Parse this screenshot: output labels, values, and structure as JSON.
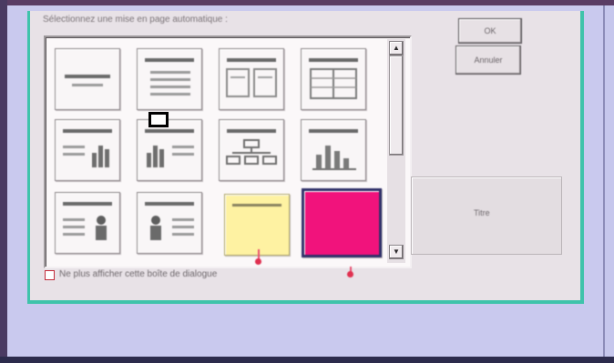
{
  "dialog": {
    "prompt": "Sélectionnez une mise en page automatique :",
    "ok_label": "OK",
    "cancel_label": "Annuler",
    "preview_label": "Titre",
    "dont_show_label": "Ne plus afficher cette boîte de dialogue"
  },
  "gallery": {
    "scroll_up_icon": "scroll-up-arrow-icon",
    "scroll_down_icon": "scroll-down-arrow-icon",
    "tiles": [
      {
        "name": "layout-title-slide",
        "icon": "title-slide-icon"
      },
      {
        "name": "layout-bulleted-list",
        "icon": "bulleted-list-icon"
      },
      {
        "name": "layout-two-columns",
        "icon": "two-column-text-icon"
      },
      {
        "name": "layout-table",
        "icon": "table-icon"
      },
      {
        "name": "layout-text-and-chart",
        "icon": "text-chart-icon"
      },
      {
        "name": "layout-chart-and-text",
        "icon": "chart-text-icon"
      },
      {
        "name": "layout-organization-chart",
        "icon": "org-chart-icon"
      },
      {
        "name": "layout-chart",
        "icon": "chart-icon"
      },
      {
        "name": "layout-text-and-clip-art",
        "icon": "text-clipart-icon"
      },
      {
        "name": "layout-clip-art-and-text",
        "icon": "clipart-text-icon"
      },
      {
        "name": "layout-title-only",
        "icon": "title-only-icon"
      },
      {
        "name": "layout-blank",
        "icon": "blank-icon"
      }
    ]
  },
  "colors": {
    "dialog_face": "#e8e2e7",
    "frame_accent": "#3fc3ab",
    "selected_highlight": "#f1137c",
    "hover_highlight": "#fef2a2",
    "selection_border": "#2f3069",
    "background": "#c6c7ec"
  }
}
